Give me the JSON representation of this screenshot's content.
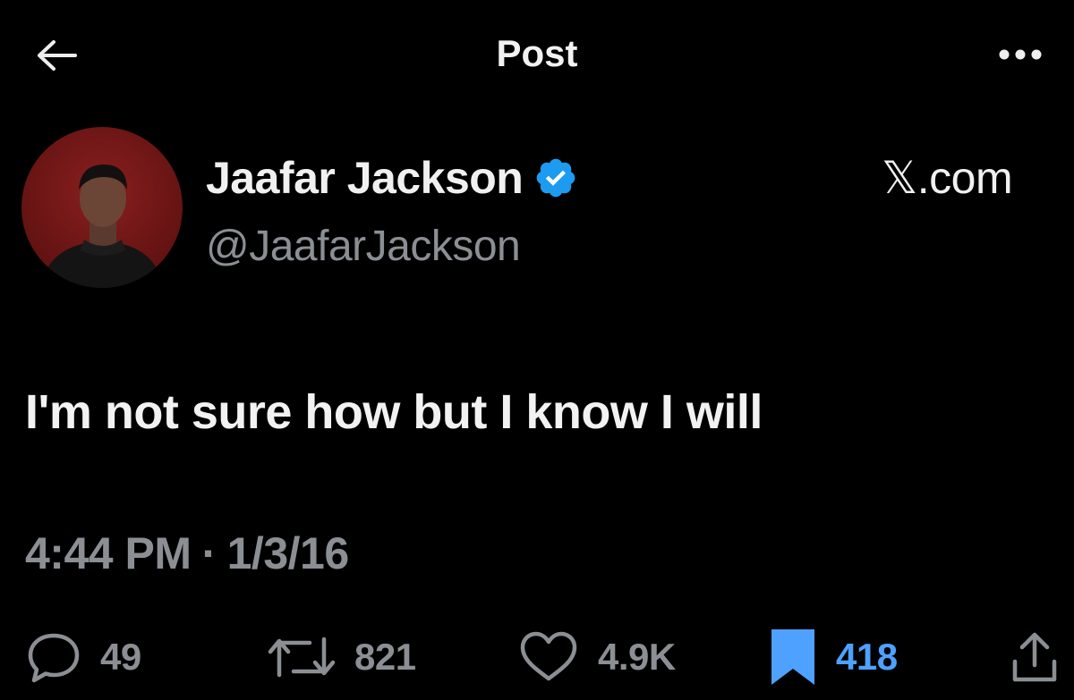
{
  "header": {
    "title": "Post"
  },
  "author": {
    "name": "Jaafar Jackson",
    "handle": "@JaafarJackson",
    "verified": true,
    "source": "𝕏.com"
  },
  "post": {
    "text": "I'm not sure how but I know I will",
    "time": "4:44 PM",
    "separator": "·",
    "date": "1/3/16"
  },
  "actions": {
    "replies": "49",
    "reposts": "821",
    "likes": "4.9K",
    "bookmarks": "418",
    "bookmarked": true
  },
  "colors": {
    "background": "#000000",
    "text": "#e7e9ea",
    "muted": "#8b8f94",
    "accent": "#4ea1ff",
    "verified": "#1d9bf0"
  },
  "icons": [
    "back-arrow-icon",
    "more-icon",
    "verified-badge-icon",
    "reply-icon",
    "repost-icon",
    "like-icon",
    "bookmark-icon",
    "share-icon"
  ]
}
